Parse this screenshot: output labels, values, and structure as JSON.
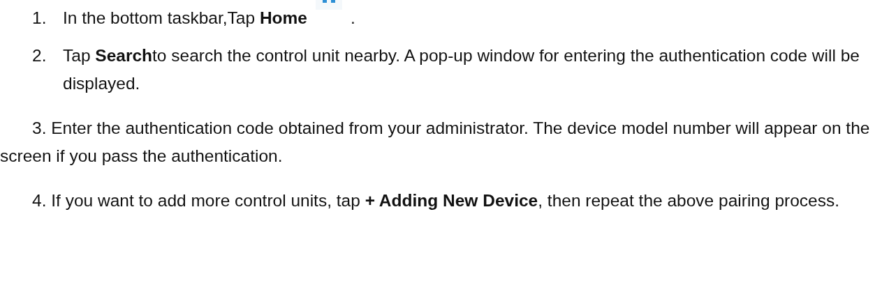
{
  "steps": [
    {
      "kind": "list",
      "number": "1.",
      "text": "In the bottom taskbar,Tap **Home**",
      "trailing": "."
    },
    {
      "kind": "list",
      "number": "2.",
      "text": "Tap **Search**to search the control unit nearby. A pop-up window for entering the authentication code will be displayed."
    },
    {
      "kind": "paragraph",
      "text": "3. Enter the authentication code obtained from your administrator. The device model number will appear on the screen if you pass the authentication."
    },
    {
      "kind": "paragraph",
      "text": "4. If you want to add more control units, tap **+ Adding New Device**, then repeat the above pairing process."
    }
  ]
}
